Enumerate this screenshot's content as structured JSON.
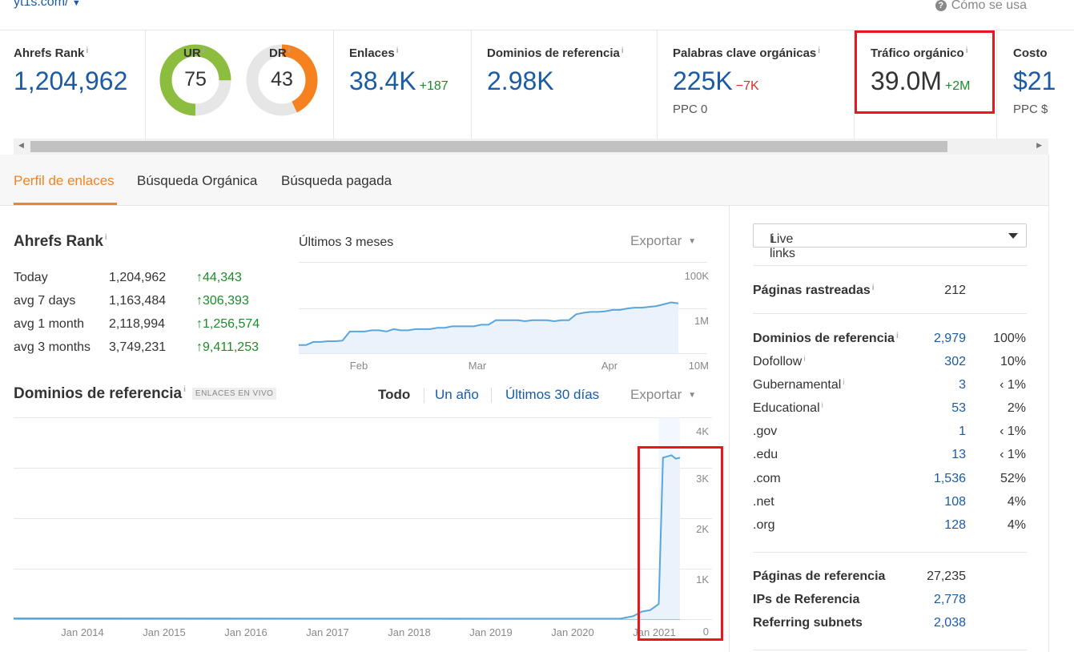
{
  "top": {
    "url": "yt1s.com/",
    "help": "Cómo se usa"
  },
  "metrics": {
    "ahrefs_rank": {
      "label": "Ahrefs Rank",
      "value": "1,204,962"
    },
    "ur": {
      "label": "UR",
      "value": "75",
      "fraction": 0.75,
      "color": "#8cbd3f"
    },
    "dr": {
      "label": "DR",
      "value": "43",
      "fraction": 0.43,
      "color": "#f5821f"
    },
    "enlaces": {
      "label": "Enlaces",
      "value": "38.4K",
      "delta": "+187"
    },
    "dominios": {
      "label": "Dominios de referencia",
      "value": "2.98K"
    },
    "palabras": {
      "label": "Palabras clave orgánicas",
      "value": "225K",
      "delta": "−7K",
      "sub": "PPC 0"
    },
    "trafico": {
      "label": "Tráfico orgánico",
      "value": "39.0M",
      "delta": "+2M"
    },
    "costo": {
      "label": "Costo",
      "value": "$21",
      "sub": "PPC $"
    }
  },
  "tabs": [
    "Perfil de enlaces",
    "Búsqueda Orgánica",
    "Búsqueda pagada"
  ],
  "rank_section": {
    "title": "Ahrefs Rank",
    "period": "Últimos 3 meses",
    "export": "Exportar",
    "rows": [
      {
        "label": "Today",
        "value": "1,204,962",
        "delta": "44,343"
      },
      {
        "label": "avg 7 days",
        "value": "1,163,484",
        "delta": "306,393"
      },
      {
        "label": "avg 1 month",
        "value": "2,118,994",
        "delta": "1,256,574"
      },
      {
        "label": "avg 3 months",
        "value": "3,749,231",
        "delta": "9,411,253"
      }
    ]
  },
  "refdomains_section": {
    "title": "Dominios de referencia",
    "badge": "ENLACES EN VIVO",
    "filters": [
      "Todo",
      "Un año",
      "Últimos 30 días"
    ],
    "export": "Exportar"
  },
  "chart_data": [
    {
      "type": "line",
      "x_ticks": [
        "Feb",
        "Mar",
        "Apr"
      ],
      "y_ticks": [
        "100K",
        "1M",
        "10M"
      ],
      "y_scale": "log",
      "y_values": [
        3400000,
        3400000,
        2900000,
        2900000,
        2800000,
        2800000,
        2700000,
        1700000,
        1700000,
        1700000,
        1600000,
        1600000,
        1700000,
        1500000,
        1600000,
        1600000,
        1500000,
        1500000,
        1500000,
        1400000,
        1400000,
        1300000,
        1300000,
        1300000,
        1300000,
        1200000,
        1200000,
        950000,
        950000,
        950000,
        950000,
        1000000,
        950000,
        950000,
        950000,
        1000000,
        950000,
        950000,
        700000,
        650000,
        620000,
        620000,
        600000,
        560000,
        560000,
        520000,
        500000,
        500000,
        480000,
        460000,
        420000,
        380000,
        400000
      ]
    },
    {
      "type": "area",
      "x_ticks": [
        "Jan 2014",
        "Jan 2015",
        "Jan 2016",
        "Jan 2017",
        "Jan 2018",
        "Jan 2019",
        "Jan 2020",
        "Jan 2021"
      ],
      "y_ticks": [
        "0",
        "1K",
        "2K",
        "3K",
        "4K"
      ],
      "ylim": [
        0,
        4000
      ],
      "series_end": [
        {
          "x": 2020.6,
          "y": 10
        },
        {
          "x": 2020.75,
          "y": 60
        },
        {
          "x": 2020.85,
          "y": 150
        },
        {
          "x": 2020.95,
          "y": 180
        },
        {
          "x": 2021.05,
          "y": 300
        },
        {
          "x": 2021.1,
          "y": 3200
        },
        {
          "x": 2021.2,
          "y": 3250
        },
        {
          "x": 2021.25,
          "y": 3180
        },
        {
          "x": 2021.3,
          "y": 3200
        }
      ]
    }
  ],
  "right_panel": {
    "select": "Live links",
    "crawled": {
      "label": "Páginas rastreadas",
      "value": "212"
    },
    "refdomains": {
      "label": "Dominios de referencia",
      "value": "2,979",
      "pct": "100%"
    },
    "breakdown": [
      {
        "label": "Dofollow",
        "value": "302",
        "pct": "10%",
        "info": true
      },
      {
        "label": "Gubernamental",
        "value": "3",
        "pct": "‹ 1%",
        "info": true
      },
      {
        "label": "Educational",
        "value": "53",
        "pct": "2%",
        "info": true
      },
      {
        "label": ".gov",
        "value": "1",
        "pct": "‹ 1%"
      },
      {
        "label": ".edu",
        "value": "13",
        "pct": "‹ 1%"
      },
      {
        "label": ".com",
        "value": "1,536",
        "pct": "52%"
      },
      {
        "label": ".net",
        "value": "108",
        "pct": "4%"
      },
      {
        "label": ".org",
        "value": "128",
        "pct": "4%"
      }
    ],
    "refpages": {
      "label": "Páginas de referencia",
      "value": "27,235"
    },
    "refips": {
      "label": "IPs de Referencia",
      "value": "2,778"
    },
    "subnets": {
      "label": "Referring subnets",
      "value": "2,038"
    }
  }
}
